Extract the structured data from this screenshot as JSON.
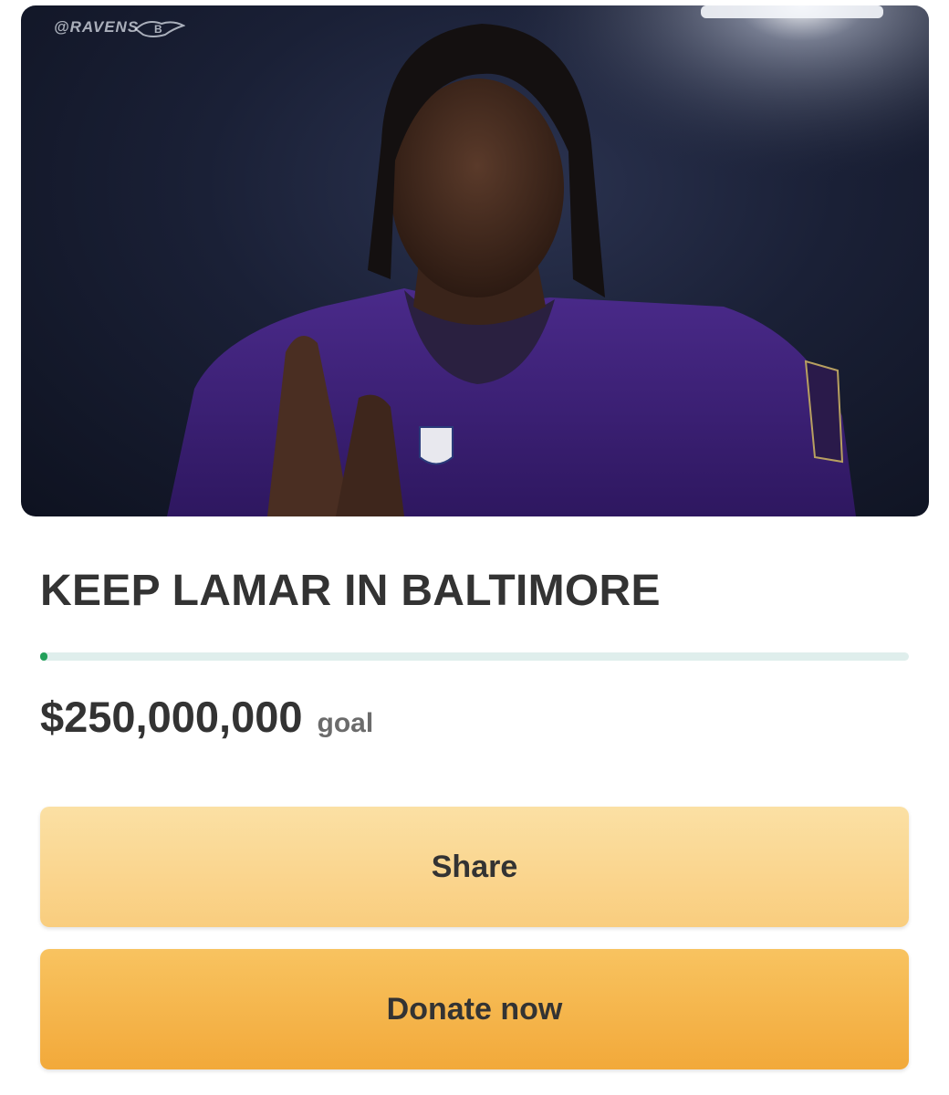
{
  "hero": {
    "watermark": "@RAVENS",
    "image_description_icon": "player-photo"
  },
  "fundraiser": {
    "title": "KEEP LAMAR IN BALTIMORE",
    "progress_fraction": 0.0,
    "goal_amount": "$250,000,000",
    "goal_label": "goal"
  },
  "actions": {
    "share_label": "Share",
    "donate_label": "Donate now"
  },
  "colors": {
    "progress_fill": "#22a05a",
    "progress_track": "#dfeeec",
    "share_button": "#f9cd7e",
    "donate_button": "#f2a93a",
    "text": "#333333"
  }
}
